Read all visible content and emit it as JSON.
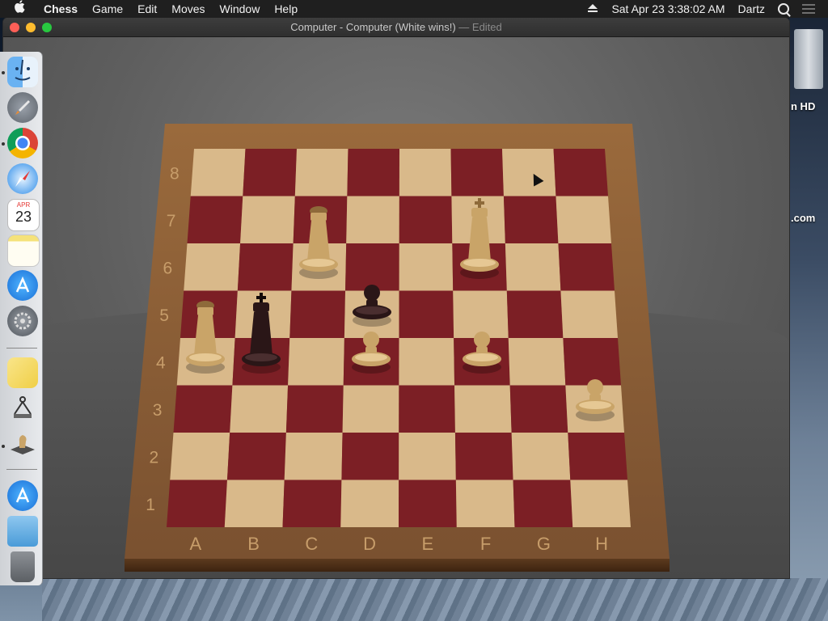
{
  "menubar": {
    "apple": "",
    "app": "Chess",
    "items": [
      "Game",
      "Edit",
      "Moves",
      "Window",
      "Help"
    ],
    "datetime": "Sat Apr 23  3:38:02 AM",
    "user": "Dartz"
  },
  "window": {
    "title_main": "Computer - Computer   (White wins!)",
    "title_suffix": "— Edited"
  },
  "desktop": {
    "right_text_1": "n HD",
    "right_text_2": ".com"
  },
  "board": {
    "files": [
      "A",
      "B",
      "C",
      "D",
      "E",
      "F",
      "G",
      "H"
    ],
    "ranks": [
      "1",
      "2",
      "3",
      "4",
      "5",
      "6",
      "7",
      "8"
    ],
    "pieces": [
      {
        "type": "queen",
        "color": "white",
        "square": "C6"
      },
      {
        "type": "king",
        "color": "white",
        "square": "F6"
      },
      {
        "type": "pawn",
        "color": "black",
        "square": "D5"
      },
      {
        "type": "queen",
        "color": "white",
        "square": "A4"
      },
      {
        "type": "king",
        "color": "black",
        "square": "B4"
      },
      {
        "type": "pawn",
        "color": "white",
        "square": "D4"
      },
      {
        "type": "pawn",
        "color": "white",
        "square": "F4"
      },
      {
        "type": "pawn",
        "color": "white",
        "square": "H3"
      }
    ]
  },
  "dock": {
    "calendar_month": "APR",
    "calendar_day": "23",
    "items": [
      "finder-icon",
      "launchpad-icon",
      "chrome-icon",
      "safari-icon",
      "calendar-icon",
      "notes-icon",
      "app-store-icon",
      "system-preferences-icon",
      "stickies-icon",
      "scanner-icon",
      "chess-icon",
      "app-store-downloads-icon",
      "folder-icon",
      "trash-icon"
    ]
  },
  "colors": {
    "light_square": "#d9b98a",
    "dark_square": "#7c1f25",
    "frame": "#8b5e34",
    "white_piece": "#c9a468",
    "black_piece": "#2a1617"
  }
}
